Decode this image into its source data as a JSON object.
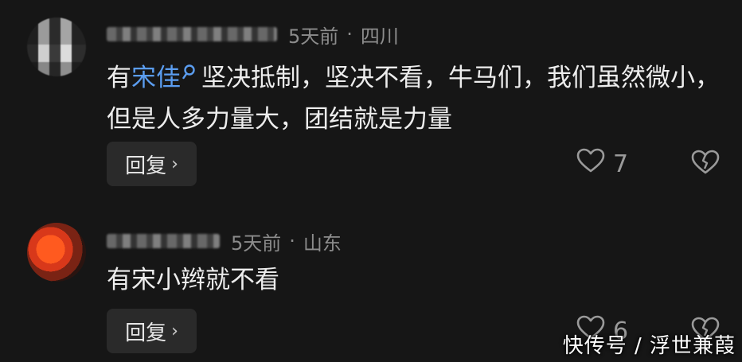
{
  "comments": [
    {
      "time": "5天前",
      "separator": "·",
      "location": "四川",
      "text_prefix": "有",
      "mention": "宋佳",
      "text_rest": "坚决抵制，坚决不看，牛马们，我们虽然微小，但是人多力量大，团结就是力量",
      "reply_label": "回复",
      "reply_chevron": "›",
      "like_count": "7"
    },
    {
      "time": "5天前",
      "separator": "·",
      "location": "山东",
      "text": "有宋小辫就不看",
      "reply_label": "回复",
      "reply_chevron": "›",
      "like_count": "6"
    }
  ],
  "watermark": "快传号 / 浮世兼葭",
  "colors": {
    "background": "#161616",
    "mention": "#5b9df0",
    "meta": "#8c8c8c",
    "button_bg": "#2a2a2a"
  },
  "icons": {
    "like": "heart-outline-icon",
    "dislike": "broken-heart-icon",
    "mention": "search-icon"
  }
}
